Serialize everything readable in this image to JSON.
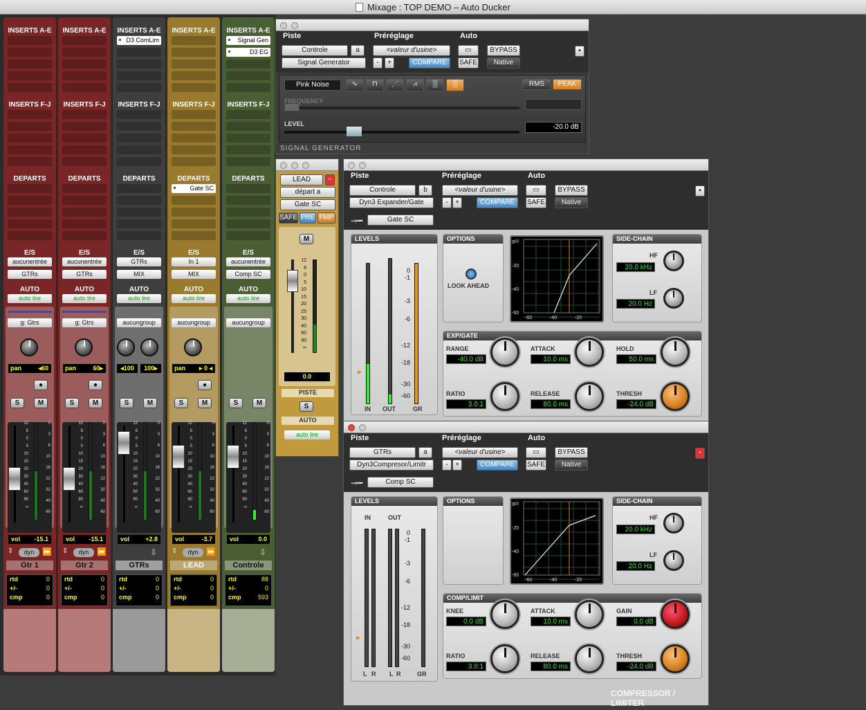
{
  "window_title": "Mixage : TOP DEMO – Auto Ducker",
  "mixer": {
    "labels": {
      "inserts_ae": "INSERTS A-E",
      "inserts_fj": "INSERTS F-J",
      "departs": "DEPARTS",
      "es": "E/S",
      "auto": "AUTO",
      "solo": "S",
      "mute": "M",
      "rtd": "rtd",
      "plusminus": "+/-",
      "cmp": "cmp",
      "vol": "vol",
      "pan": "pan",
      "dyn": "dyn"
    },
    "strips": [
      {
        "name": "Gtr 1",
        "color": "#7a2626",
        "foot": "#b77a7a",
        "input": "aucunentrée",
        "output": "GTRs",
        "auto": "auto lire",
        "group": "g: Gtrs",
        "pan": "◂60",
        "vol": "-15.1",
        "inserts": [],
        "sends": [],
        "rtd": "0",
        "pm": "0",
        "cmp": "0"
      },
      {
        "name": "Gtr 2",
        "color": "#7a2626",
        "foot": "#b77a7a",
        "input": "aucunentrée",
        "output": "GTRs",
        "auto": "auto lire",
        "group": "g: Gtrs",
        "pan": "60▸",
        "vol": "-15.1",
        "inserts": [],
        "sends": [],
        "rtd": "0",
        "pm": "0",
        "cmp": "0"
      },
      {
        "name": "GTRs",
        "color": "#3e3e3e",
        "foot": "#9a9a9a",
        "input": "GTRs",
        "output": "MIX",
        "auto": "auto lire",
        "group": "aucungroup",
        "pan_l": "◂100",
        "pan_r": "100▸",
        "vol": "+2.8",
        "inserts": [
          "D3 ComLim"
        ],
        "sends": [],
        "rtd": "0",
        "pm": "0",
        "cmp": "0"
      },
      {
        "name": "LEAD",
        "color": "#9a7a2c",
        "foot": "#c8b585",
        "input": "In 1",
        "output": "MIX",
        "auto": "auto lire",
        "group": "aucungroup",
        "pan": "▸ 0 ◂",
        "vol": "-3.7",
        "inserts": [],
        "sends": [
          "Gate SC"
        ],
        "rtd": "0",
        "pm": "0",
        "cmp": "0"
      },
      {
        "name": "Controle",
        "color": "#4a5e34",
        "foot": "#a6ae95",
        "input": "aucunentrée",
        "output": "Comp SC",
        "auto": "auto lire",
        "group": "aucungroup",
        "vol": "0.0",
        "inserts": [
          "Signal Gen",
          "D3 EG"
        ],
        "sends": [],
        "rtd": "88",
        "pm": "0",
        "cmp": "593"
      }
    ],
    "fader_scale": [
      "12",
      "6",
      "0",
      "5",
      "10",
      "15",
      "20",
      "30",
      "40",
      "60",
      "90",
      "∞"
    ],
    "meter_scale": [
      "0",
      "3",
      "6",
      "10",
      "16",
      "22",
      "32",
      "40",
      "60"
    ]
  },
  "signal_gen": {
    "piste": "Piste",
    "preset": "Préréglage",
    "auto": "Auto",
    "track": "Controle",
    "slot": "a",
    "plugin": "Signal Generator",
    "preset_value": "<valeur d'usine>",
    "minus": "-",
    "plus": "+",
    "compare": "COMPARE",
    "bypass": "BYPASS",
    "safe": "SAFE",
    "native": "Native",
    "noise": "Pink Noise",
    "rms": "RMS",
    "peak": "PEAK",
    "frequency_label": "FREQUENCY",
    "level_label": "LEVEL",
    "level_value": "-20.0 dB",
    "brand": "SIGNAL GENERATOR"
  },
  "lead_window": {
    "track": "LEAD",
    "send": "départ a",
    "dest": "Gate SC",
    "safe": "SAFE",
    "pre": "PRE",
    "fmp": "FMP",
    "m": "M",
    "value": "0.0",
    "piste": "PISTE",
    "s": "S",
    "auto": "AUTO",
    "auto_mode": "auto lire",
    "fader_scale": [
      "12",
      "6",
      "0",
      "5",
      "10",
      "15",
      "20",
      "25",
      "30",
      "40",
      "60",
      "90",
      "∞"
    ]
  },
  "gate": {
    "piste": "Piste",
    "preset": "Préréglage",
    "auto": "Auto",
    "track": "Controle",
    "slot": "b",
    "plugin": "Dyn3 Expander/Gate",
    "preset_value": "<valeur d'usine>",
    "compare": "COMPARE",
    "bypass": "BYPASS",
    "safe": "SAFE",
    "native": "Native",
    "key": "Gate SC",
    "levels": "LEVELS",
    "options": "OPTIONS",
    "look_ahead": "LOOK AHEAD",
    "side_chain": "SIDE-CHAIN",
    "hf": "HF",
    "hf_val": "20.0 kHz",
    "lf": "LF",
    "lf_val": "20.0 Hz",
    "section": "EXP/GATE",
    "range": "RANGE",
    "range_val": "-40.0 dB",
    "attack": "ATTACK",
    "attack_val": "10.0 ms",
    "hold": "HOLD",
    "hold_val": "50.0 ms",
    "ratio": "RATIO",
    "ratio_val": "3.0:1",
    "release": "RELEASE",
    "release_val": "80.0 ms",
    "thresh": "THRESH",
    "thresh_val": "-24.0 dB",
    "in": "IN",
    "out": "OUT",
    "gr": "GR",
    "meter_scale": [
      "0",
      "-1",
      "-3",
      "-6",
      "-12",
      "-18",
      "-30",
      "-60"
    ],
    "graph_db": "dB",
    "graph_y": [
      "0",
      "-20",
      "-40",
      "-60"
    ],
    "graph_x": [
      "-60",
      "-40",
      "-20"
    ]
  },
  "comp": {
    "piste": "Piste",
    "preset": "Préréglage",
    "auto": "Auto",
    "track": "GTRs",
    "slot": "a",
    "plugin": "Dyn3Compresor/Limitr",
    "preset_value": "<valeur d'usine>",
    "compare": "COMPARE",
    "bypass": "BYPASS",
    "safe": "SAFE",
    "native": "Native",
    "key": "Comp SC",
    "levels": "LEVELS",
    "options": "OPTIONS",
    "side_chain": "SIDE-CHAIN",
    "hf": "HF",
    "hf_val": "20.0 kHz",
    "lf": "LF",
    "lf_val": "20.0 Hz",
    "section": "COMP/LIMIT",
    "knee": "KNEE",
    "knee_val": "0.0 dB",
    "attack": "ATTACK",
    "attack_val": "10.0 ms",
    "gain": "GAIN",
    "gain_val": "0.0 dB",
    "ratio": "RATIO",
    "ratio_val": "3.0:1",
    "release": "RELEASE",
    "release_val": "80.0 ms",
    "thresh": "THRESH",
    "thresh_val": "-24.0 dB",
    "in": "IN",
    "out": "OUT",
    "gr": "GR",
    "l": "L",
    "r": "R",
    "brand": "COMPRESSOR / LIMITER",
    "meter_scale": [
      "0",
      "-1",
      "-3",
      "-6",
      "-12",
      "-18",
      "-30",
      "-60"
    ],
    "graph_db": "dB",
    "graph_y": [
      "0",
      "-20",
      "-40",
      "-60"
    ],
    "graph_x": [
      "-60",
      "-40",
      "-20"
    ]
  }
}
